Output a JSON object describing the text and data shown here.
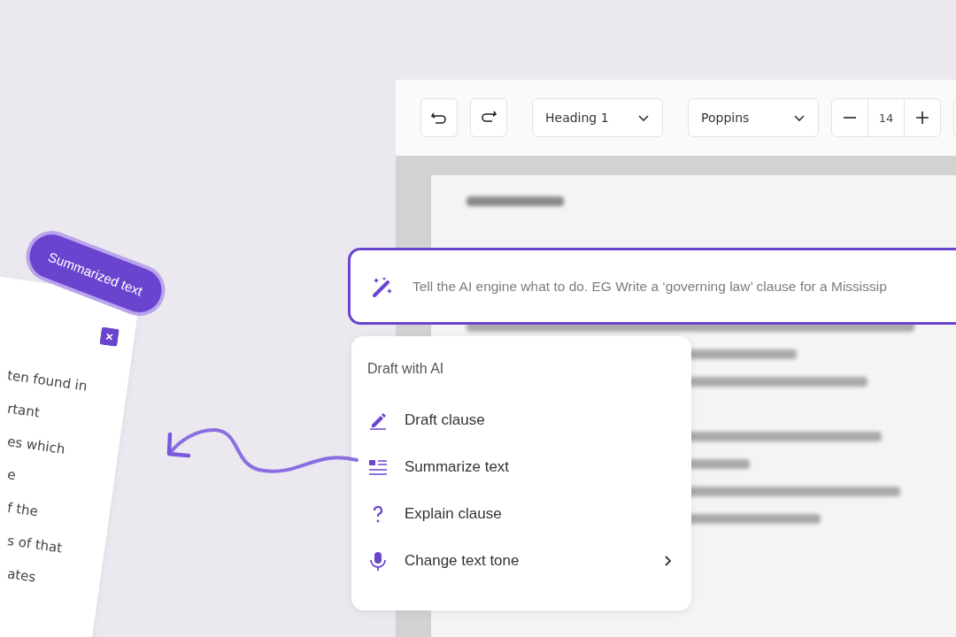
{
  "toolbar": {
    "style_dropdown": "Heading 1",
    "font_dropdown": "Poppins",
    "font_size": "14"
  },
  "ai_prompt": {
    "placeholder": "Tell the AI engine what to do. EG Write a ‘governing law’ clause for a Mississip"
  },
  "ai_menu": {
    "title": "Draft with AI",
    "items": [
      {
        "label": "Draft clause",
        "kind": "pen",
        "has_submenu": false
      },
      {
        "label": "Summarize text",
        "kind": "lines",
        "has_submenu": false
      },
      {
        "label": "Explain clause",
        "kind": "question",
        "has_submenu": false
      },
      {
        "label": "Change text tone",
        "kind": "mic",
        "has_submenu": true
      }
    ]
  },
  "summary_card": {
    "badge": "Summarized text",
    "lines": [
      "ten found in",
      "rtant",
      "es which",
      "e",
      "f the",
      "s of that",
      "ates"
    ]
  }
}
